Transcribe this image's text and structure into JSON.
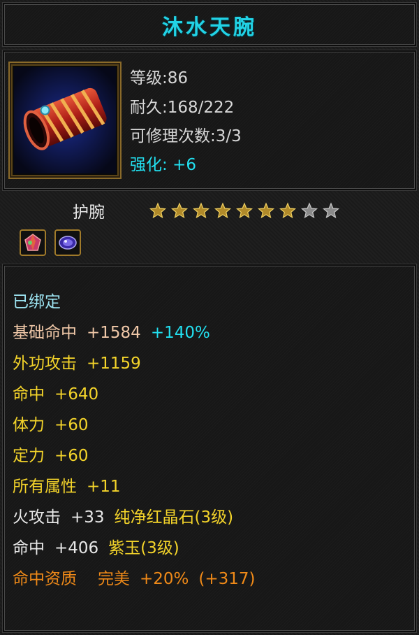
{
  "item": {
    "name": "沐水天腕",
    "level": "等级:86",
    "durability": "耐久:168/222",
    "repair": "可修理次数:3/3",
    "enhance_label": "强化:",
    "enhance_value": "+6",
    "type": "护腕",
    "stars": {
      "filled": 7,
      "total": 9
    },
    "icon": "red-bracer-icon",
    "gems": [
      "red-crystal-gem-icon",
      "purple-jade-gem-icon"
    ]
  },
  "attributes": {
    "bound": "已绑定",
    "base_hit_label": "基础命中",
    "base_hit_value": "+1584",
    "base_hit_pct": "+140%",
    "ext_atk_label": "外功攻击",
    "ext_atk_value": "+1159",
    "hit_label": "命中",
    "hit_value": "+640",
    "stamina_label": "体力",
    "stamina_value": "+60",
    "focus_label": "定力",
    "focus_value": "+60",
    "all_attr_label": "所有属性",
    "all_attr_value": "+11",
    "fire_label": "火攻击",
    "fire_value": "+33",
    "fire_gem": "纯净红晶石(3级)",
    "hit2_label": "命中",
    "hit2_value": "+406",
    "hit2_gem": "紫玉(3级)",
    "quality_label": "命中资质",
    "quality_grade": "完美",
    "quality_pct": "+20%",
    "quality_bonus": "(+317)"
  },
  "colors": {
    "title": "#22d3e6",
    "bound": "#9de4f2",
    "base": "#f0c8a8",
    "stat": "#f4d42a",
    "gem": "#f4d42a",
    "cyan": "#22e0f0",
    "orange": "#f08a18"
  }
}
